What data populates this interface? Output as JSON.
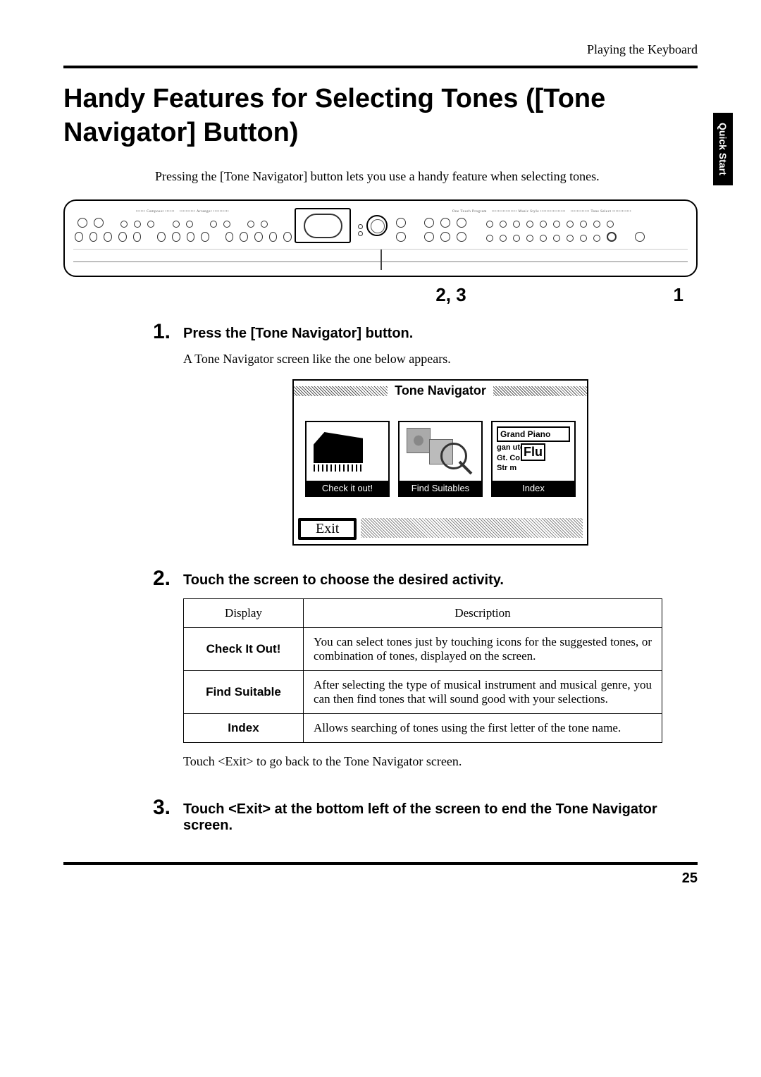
{
  "header": {
    "section": "Playing the Keyboard"
  },
  "sideTab": "Quick Start",
  "title": "Handy Features for Selecting Tones ([Tone Navigator] Button)",
  "intro": "Pressing the [Tone Navigator] button lets you use a handy feature when selecting tones.",
  "diagram": {
    "stepsLabel": "2, 3",
    "rightLabel": "1"
  },
  "steps": [
    {
      "num": "1.",
      "heading": "Press the [Tone Navigator] button.",
      "text": "A Tone Navigator screen like the one below appears."
    },
    {
      "num": "2.",
      "heading": "Touch the screen to choose the desired activity."
    },
    {
      "num": "3.",
      "heading": "Touch <Exit> at the bottom left of the screen to end the Tone Navigator screen."
    }
  ],
  "toneNavScreen": {
    "title": "Tone Navigator",
    "cards": [
      {
        "label": "Check it out!"
      },
      {
        "label": "Find Suitables"
      },
      {
        "label": "Index",
        "topText": "Grand Piano",
        "lines": [
          "gan      ute",
          "Gt.           Co",
          "Str          m"
        ],
        "flu": "Flu"
      }
    ],
    "exit": "Exit"
  },
  "table": {
    "headers": [
      "Display",
      "Description"
    ],
    "rows": [
      {
        "label": "Check It Out!",
        "desc": "You can select tones just by touching icons for the suggested tones, or combination of tones, displayed on the screen."
      },
      {
        "label": "Find Suitable",
        "desc": "After selecting the type of musical instrument and musical genre, you can then find tones that will sound good with your selections."
      },
      {
        "label": "Index",
        "desc": "Allows searching of tones using the first letter of the tone name."
      }
    ],
    "note": "Touch <Exit> to go back to the Tone Navigator screen."
  },
  "pageNum": "25"
}
